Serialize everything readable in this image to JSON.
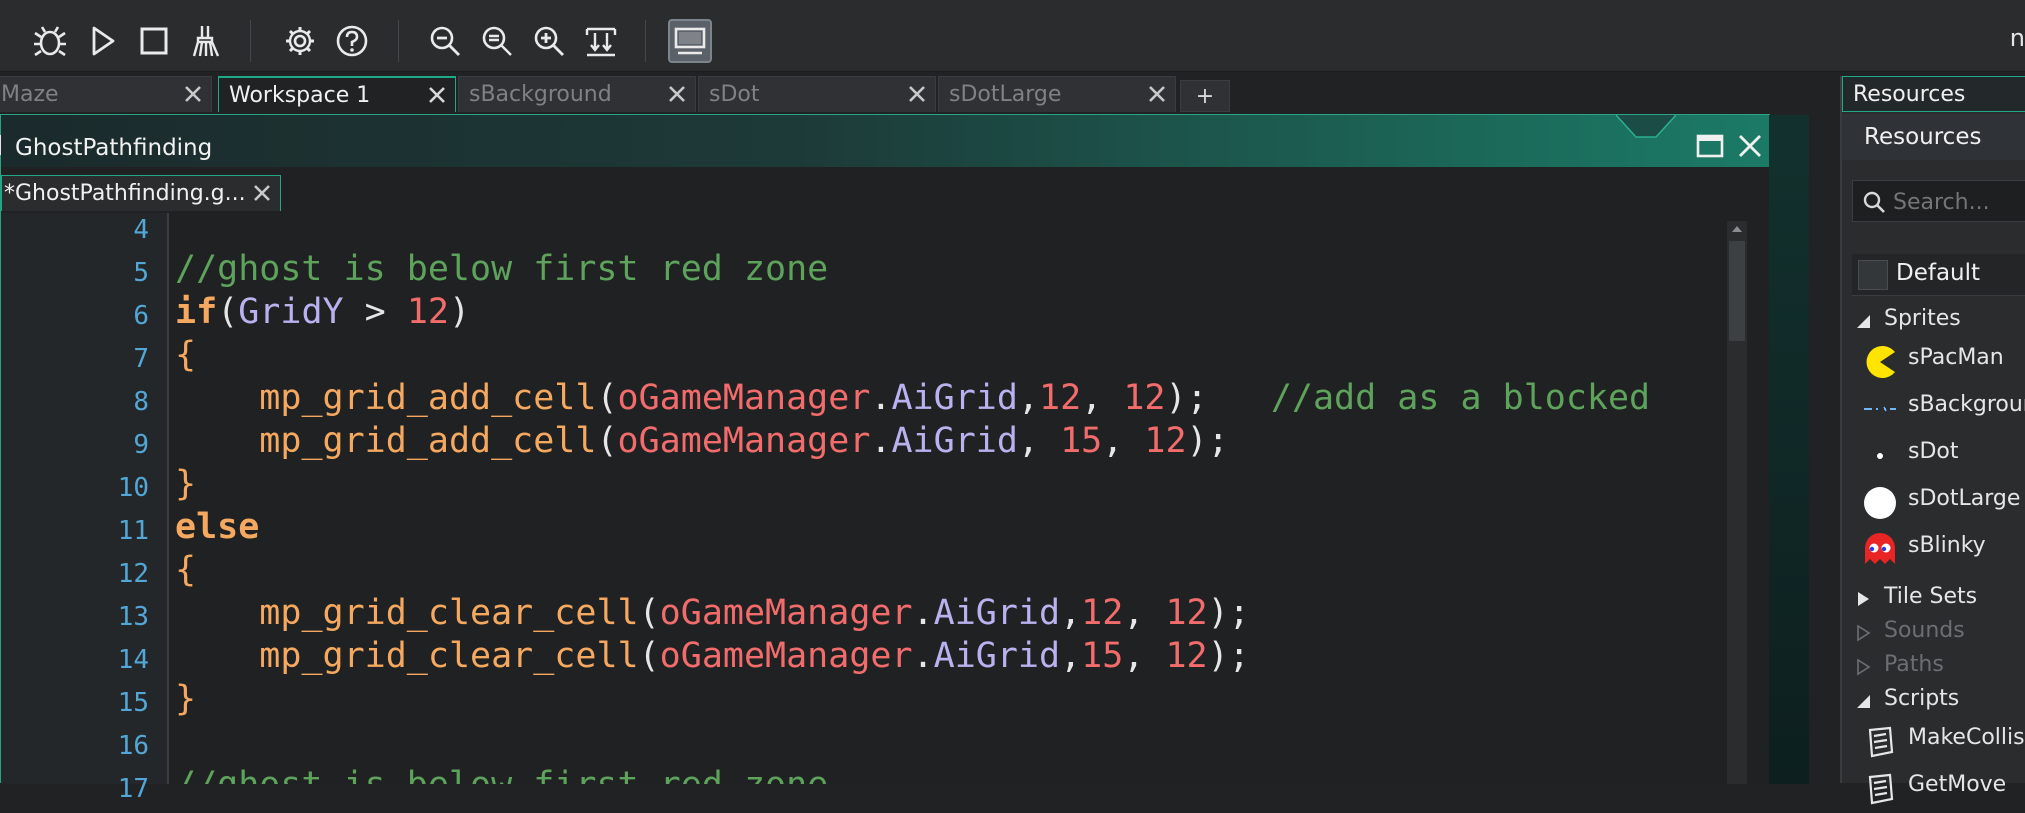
{
  "toolbar": {
    "buttons": [
      {
        "name": "debug",
        "icon": "bug-icon"
      },
      {
        "name": "run",
        "icon": "play-icon"
      },
      {
        "name": "stop",
        "icon": "stop-icon"
      },
      {
        "name": "clean",
        "icon": "broom-icon"
      },
      {
        "name": "settings",
        "icon": "gear-icon"
      },
      {
        "name": "help",
        "icon": "help-icon"
      },
      {
        "name": "zoom-out",
        "icon": "zoom-out-icon"
      },
      {
        "name": "zoom-reset",
        "icon": "zoom-reset-icon"
      },
      {
        "name": "zoom-in",
        "icon": "zoom-in-icon"
      },
      {
        "name": "fit",
        "icon": "fit-icon"
      },
      {
        "name": "target",
        "icon": "monitor-icon"
      }
    ],
    "right_text": "n"
  },
  "tabs": [
    {
      "label": "Maze",
      "active": false
    },
    {
      "label": "Workspace 1",
      "active": true
    },
    {
      "label": "sBackground",
      "active": false
    },
    {
      "label": "sDot",
      "active": false
    },
    {
      "label": "sDotLarge",
      "active": false
    }
  ],
  "add_tab_label": "+",
  "window": {
    "title": "GhostPathfinding",
    "subtab": "*GhostPathfinding.g..."
  },
  "editor": {
    "line_numbers": [
      "4",
      "5",
      "6",
      "7",
      "8",
      "9",
      "10",
      "11",
      "12",
      "13",
      "14",
      "15",
      "16",
      "17"
    ],
    "lines": [
      [],
      [
        [
          "cm",
          "//ghost is below first red zone"
        ]
      ],
      [
        [
          "kw",
          "if"
        ],
        [
          "pn",
          "("
        ],
        [
          "vr",
          "GridY"
        ],
        [
          "pn",
          " > "
        ],
        [
          "nm",
          "12"
        ],
        [
          "pn",
          ")"
        ]
      ],
      [
        [
          "fn",
          "{"
        ]
      ],
      [
        [
          "pn",
          "    "
        ],
        [
          "fn",
          "mp_grid_add_cell"
        ],
        [
          "pn",
          "("
        ],
        [
          "ob",
          "oGameManager"
        ],
        [
          "pn",
          "."
        ],
        [
          "vr",
          "AiGrid"
        ],
        [
          "pn",
          ","
        ],
        [
          "nm",
          "12"
        ],
        [
          "pn",
          ", "
        ],
        [
          "nm",
          "12"
        ],
        [
          "pn",
          ");   "
        ],
        [
          "cm",
          "//add as a blocked"
        ]
      ],
      [
        [
          "pn",
          "    "
        ],
        [
          "fn",
          "mp_grid_add_cell"
        ],
        [
          "pn",
          "("
        ],
        [
          "ob",
          "oGameManager"
        ],
        [
          "pn",
          "."
        ],
        [
          "vr",
          "AiGrid"
        ],
        [
          "pn",
          ", "
        ],
        [
          "nm",
          "15"
        ],
        [
          "pn",
          ", "
        ],
        [
          "nm",
          "12"
        ],
        [
          "pn",
          ");"
        ]
      ],
      [
        [
          "fn",
          "}"
        ]
      ],
      [
        [
          "kw",
          "else"
        ]
      ],
      [
        [
          "fn",
          "{"
        ]
      ],
      [
        [
          "pn",
          "    "
        ],
        [
          "fn",
          "mp_grid_clear_cell"
        ],
        [
          "pn",
          "("
        ],
        [
          "ob",
          "oGameManager"
        ],
        [
          "pn",
          "."
        ],
        [
          "vr",
          "AiGrid"
        ],
        [
          "pn",
          ","
        ],
        [
          "nm",
          "12"
        ],
        [
          "pn",
          ", "
        ],
        [
          "nm",
          "12"
        ],
        [
          "pn",
          ");"
        ]
      ],
      [
        [
          "pn",
          "    "
        ],
        [
          "fn",
          "mp_grid_clear_cell"
        ],
        [
          "pn",
          "("
        ],
        [
          "ob",
          "oGameManager"
        ],
        [
          "pn",
          "."
        ],
        [
          "vr",
          "AiGrid"
        ],
        [
          "pn",
          ","
        ],
        [
          "nm",
          "15"
        ],
        [
          "pn",
          ", "
        ],
        [
          "nm",
          "12"
        ],
        [
          "pn",
          ");"
        ]
      ],
      [
        [
          "fn",
          "}"
        ]
      ],
      [],
      [
        [
          "cm",
          "//ghost is below first red zone"
        ]
      ]
    ]
  },
  "resources": {
    "header": "Resources",
    "subheader": "Resources",
    "search_placeholder": "Search...",
    "default_label": "Default",
    "groups": [
      {
        "label": "Sprites",
        "expanded": true,
        "dim": false
      },
      {
        "label": "Tile Sets",
        "expanded": false,
        "dim": false
      },
      {
        "label": "Sounds",
        "expanded": false,
        "dim": true
      },
      {
        "label": "Paths",
        "expanded": false,
        "dim": true
      },
      {
        "label": "Scripts",
        "expanded": true,
        "dim": false
      }
    ],
    "sprites": [
      {
        "label": "sPacMan",
        "icon": "pacman-icon"
      },
      {
        "label": "sBackground",
        "icon": "background-icon"
      },
      {
        "label": "sDot",
        "icon": "dot-icon"
      },
      {
        "label": "sDotLarge",
        "icon": "large-dot-icon"
      },
      {
        "label": "sBlinky",
        "icon": "ghost-icon"
      }
    ],
    "scripts": [
      {
        "label": "MakeCollision",
        "icon": "script-icon"
      },
      {
        "label": "GetMove",
        "icon": "script-icon"
      }
    ]
  },
  "colors": {
    "accent": "#1fa987",
    "comment": "#5ea35b",
    "keyword": "#f5a85f",
    "object": "#f26c6c",
    "variable": "#b8b3f0",
    "number": "#f26c6c",
    "line_number": "#52a7d6"
  }
}
